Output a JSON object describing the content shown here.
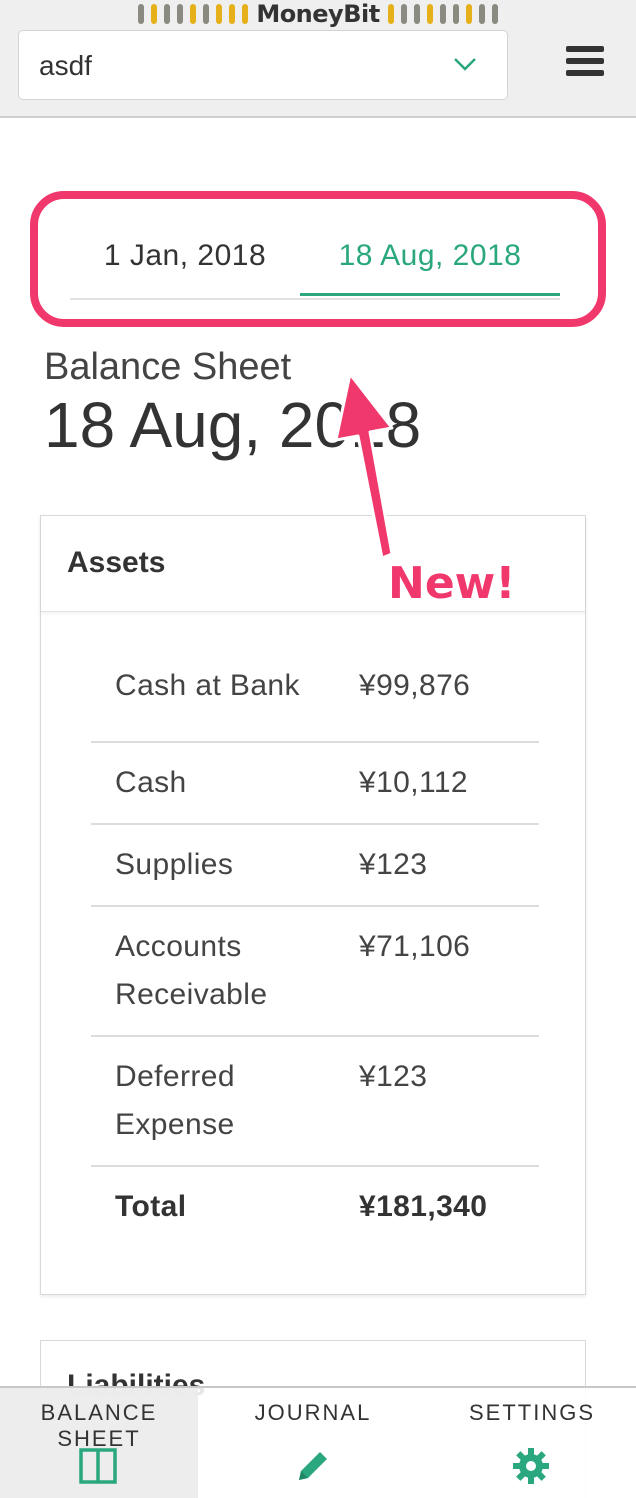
{
  "brand": {
    "name": "MoneyBit",
    "accent": "#2aa77f",
    "highlight": "#f0386c"
  },
  "book_select": {
    "value": "asdf"
  },
  "date_tabs": [
    {
      "label": "1 Jan, 2018"
    },
    {
      "label": "18 Aug, 2018",
      "selected": true
    }
  ],
  "sheet": {
    "label": "Balance Sheet",
    "date": "18 Aug, 2018"
  },
  "annotation": {
    "text": "New!"
  },
  "assets": {
    "title": "Assets",
    "rows": [
      {
        "name": "Cash at Bank",
        "amount": "¥99,876"
      },
      {
        "name": "Cash",
        "amount": "¥10,112"
      },
      {
        "name": "Supplies",
        "amount": "¥123"
      },
      {
        "name": "Accounts Receivable",
        "amount": "¥71,106"
      },
      {
        "name": "Deferred Expense",
        "amount": "¥123"
      }
    ],
    "total": {
      "name": "Total",
      "amount": "¥181,340"
    }
  },
  "liabilities": {
    "title": "Liabilities"
  },
  "nav": [
    {
      "label": "BALANCE SHEET",
      "icon": "columns-icon",
      "active": true
    },
    {
      "label": "JOURNAL",
      "icon": "pencil-icon"
    },
    {
      "label": "SETTINGS",
      "icon": "gear-icon"
    }
  ]
}
